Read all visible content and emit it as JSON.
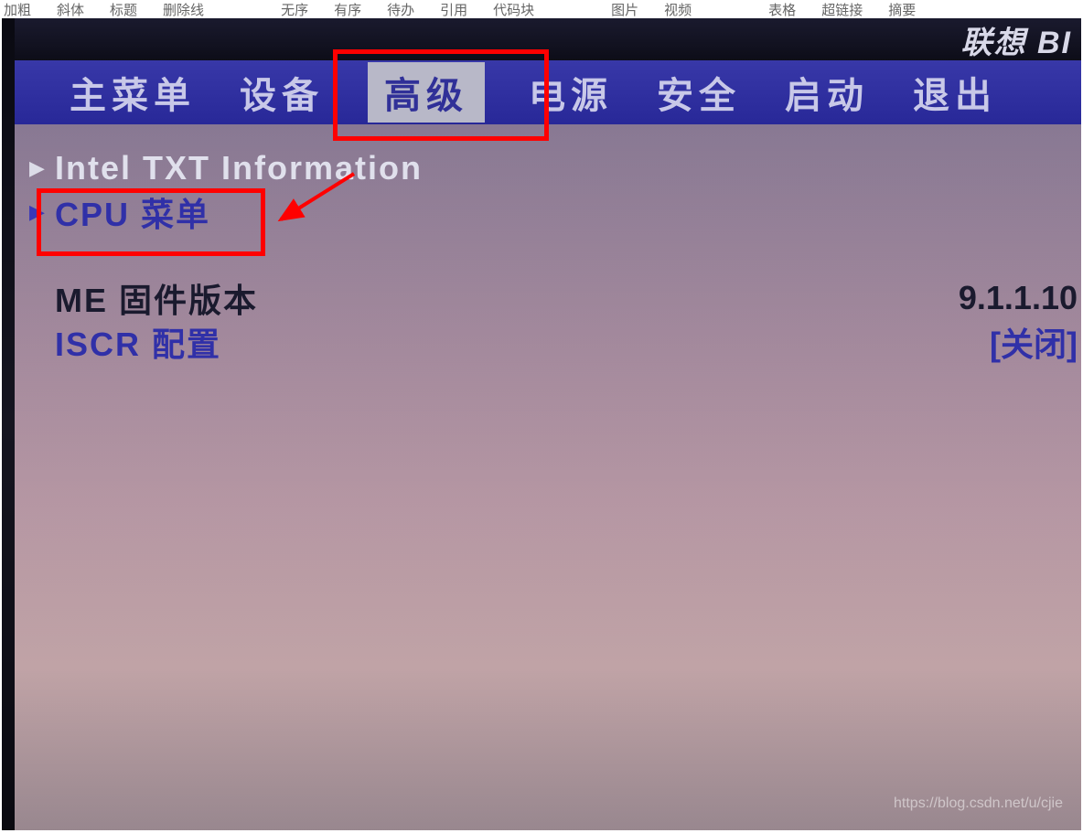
{
  "editor_toolbar": {
    "items": [
      "加粗",
      "斜体",
      "标题",
      "删除线",
      "无序",
      "有序",
      "待办",
      "引用",
      "代码块",
      "图片",
      "视频",
      "表格",
      "超链接",
      "摘要"
    ]
  },
  "bios": {
    "brand": "联想 BI",
    "menu": {
      "items": [
        {
          "label": "主菜单",
          "active": false
        },
        {
          "label": "设备",
          "active": false
        },
        {
          "label": "高级",
          "active": true
        },
        {
          "label": "电源",
          "active": false
        },
        {
          "label": "安全",
          "active": false
        },
        {
          "label": "启动",
          "active": false
        },
        {
          "label": "退出",
          "active": false
        }
      ]
    },
    "content": {
      "intel_txt": "Intel TXT Information",
      "cpu_menu": "CPU 菜单",
      "me_firmware_label": "ME 固件版本",
      "me_firmware_value": "9.1.1.10",
      "iscr_label": "ISCR 配置",
      "iscr_value": "[关闭]"
    }
  },
  "watermark": "https://blog.csdn.net/u/cjie"
}
